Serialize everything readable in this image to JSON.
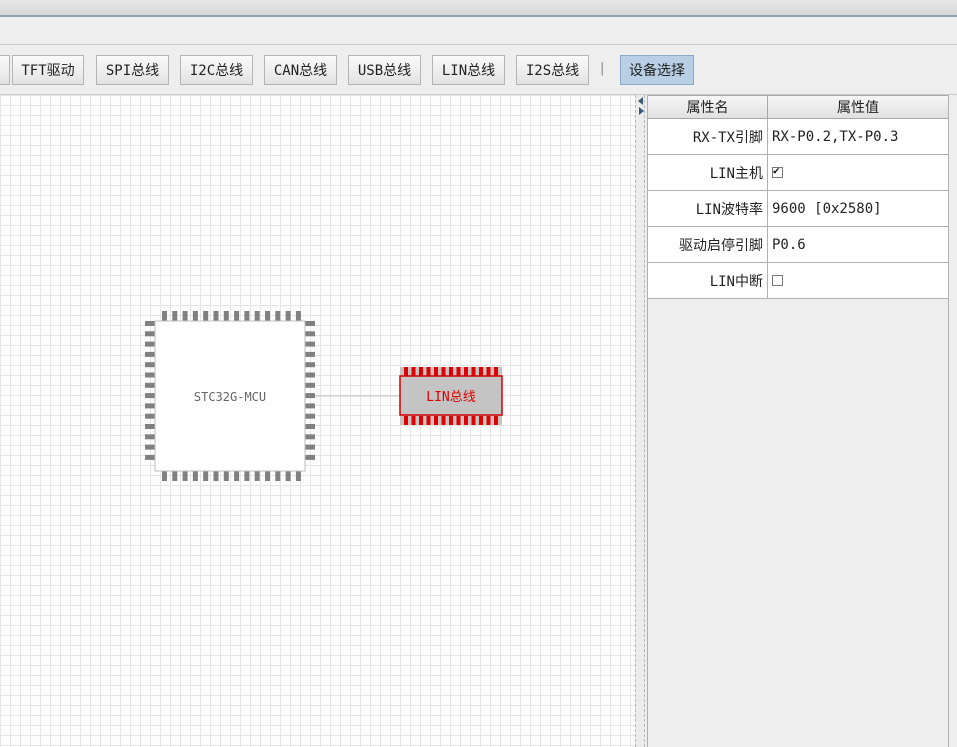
{
  "toolbar": {
    "buttons": [
      {
        "label": "TFT驱动"
      },
      {
        "label": "SPI总线"
      },
      {
        "label": "I2C总线"
      },
      {
        "label": "CAN总线"
      },
      {
        "label": "USB总线"
      },
      {
        "label": "LIN总线"
      },
      {
        "label": "I2S总线"
      }
    ],
    "separator": "|",
    "device_select": "设备选择"
  },
  "canvas": {
    "mcu_label": "STC32G-MCU",
    "lin_label": "LIN总线",
    "lin_color": "#e00000"
  },
  "properties": {
    "header_name": "属性名",
    "header_value": "属性值",
    "rows": [
      {
        "name": "RX-TX引脚",
        "value": "RX-P0.2,TX-P0.3"
      },
      {
        "name": "LIN主机",
        "checked": true
      },
      {
        "name": "LIN波特率",
        "value": "9600 [0x2580]"
      },
      {
        "name": "驱动启停引脚",
        "value": "P0.6"
      },
      {
        "name": "LIN中断",
        "checked": false
      }
    ]
  }
}
